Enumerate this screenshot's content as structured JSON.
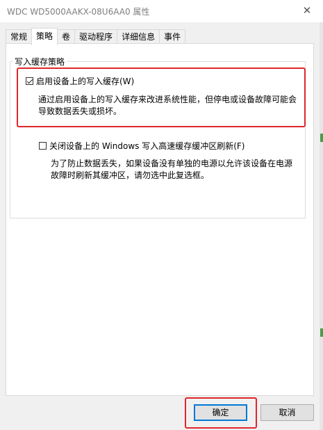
{
  "window": {
    "title": "WDC WD5000AAKX-08U6AA0 属性",
    "close_glyph": "✕"
  },
  "tabs": [
    {
      "label": "常规",
      "active": false
    },
    {
      "label": "策略",
      "active": true
    },
    {
      "label": "卷",
      "active": false
    },
    {
      "label": "驱动程序",
      "active": false
    },
    {
      "label": "详细信息",
      "active": false
    },
    {
      "label": "事件",
      "active": false
    }
  ],
  "write_cache": {
    "group_label": "写入缓存策略",
    "enable_cache": {
      "label": "启用设备上的写入缓存(W)",
      "checked": true,
      "desc_line1": "通过启用设备上的写入缓存来改进系统性能，但停电或设备故障可能会",
      "desc_line2": "导致数据丢失或损坏。"
    },
    "disable_flush": {
      "label": "关闭设备上的 Windows 写入高速缓存缓冲区刷新(F)",
      "checked": false,
      "desc_line1": "为了防止数据丢失，如果设备没有单独的电源以允许该设备在电源",
      "desc_line2": "故障时刷新其缓冲区，请勿选中此复选框。"
    }
  },
  "buttons": {
    "ok": "确定",
    "cancel": "取消"
  },
  "colors": {
    "highlight": "#e0262b",
    "default_button_border": "#0078d7"
  }
}
